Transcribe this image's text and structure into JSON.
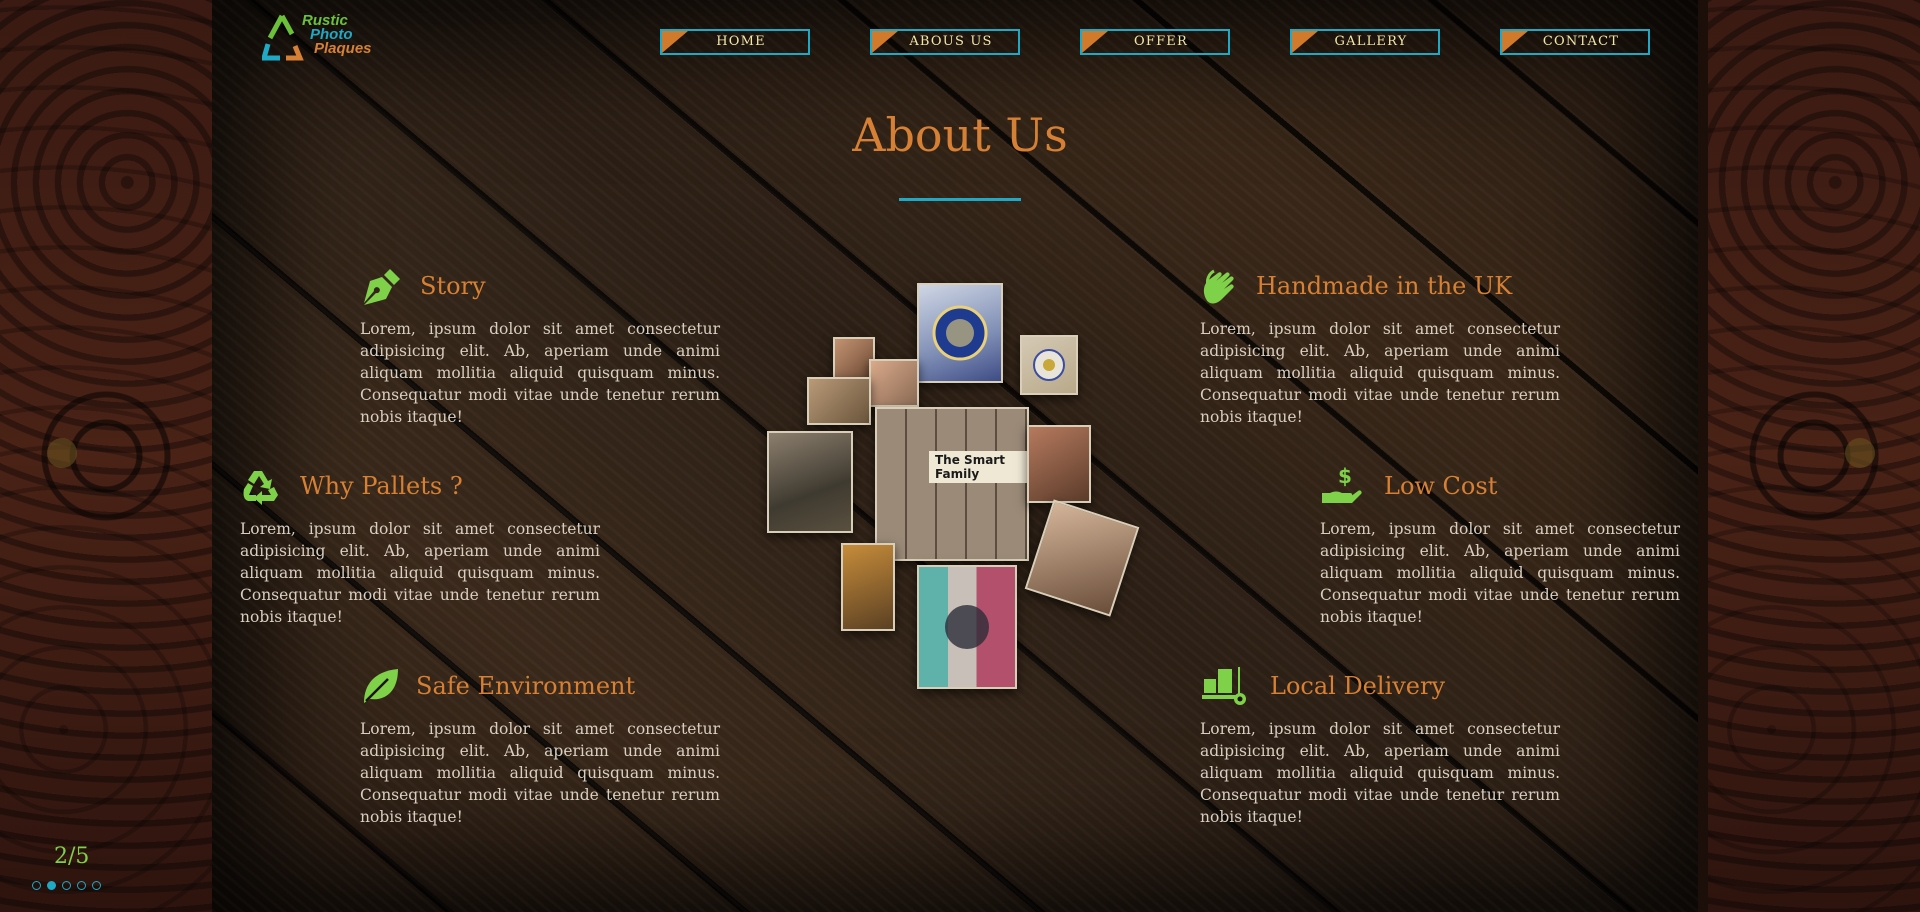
{
  "brand": {
    "logo_lines": [
      "Rustic",
      "Photo",
      "Plaques"
    ],
    "colors": {
      "rustic": "#6cc13a",
      "photo": "#1fa9c4",
      "plaques": "#d58034"
    }
  },
  "nav": [
    {
      "label": "HOME"
    },
    {
      "label": "ABOUS US"
    },
    {
      "label": "OFFER"
    },
    {
      "label": "GALLERY"
    },
    {
      "label": "CONTACT"
    }
  ],
  "page": {
    "title": "About Us"
  },
  "features": {
    "story": {
      "icon": "pen-nib-icon",
      "title": "Story",
      "body": "Lorem, ipsum dolor sit amet consectetur adipisicing elit. Ab, aperiam unde animi aliquam mollitia aliquid quisquam minus. Consequatur modi vitae unde tenetur rerum nobis itaque!"
    },
    "handmade": {
      "icon": "hands-icon",
      "title": "Handmade in the UK",
      "body": "Lorem, ipsum dolor sit amet consectetur adipisicing elit. Ab, aperiam unde animi aliquam mollitia aliquid quisquam minus. Consequatur modi vitae unde tenetur rerum nobis itaque!"
    },
    "pallets": {
      "icon": "recycle-icon",
      "title": "Why Pallets ?",
      "body": "Lorem, ipsum dolor sit amet consectetur adipisicing elit. Ab, aperiam unde animi aliquam mollitia aliquid quisquam minus. Consequatur modi vitae unde tenetur rerum nobis itaque!"
    },
    "lowcost": {
      "icon": "hand-dollar-icon",
      "title": "Low Cost",
      "body": "Lorem, ipsum dolor sit amet consectetur adipisicing elit. Ab, aperiam unde animi aliquam mollitia aliquid quisquam minus. Consequatur modi vitae unde tenetur rerum nobis itaque!"
    },
    "safe": {
      "icon": "leaf-icon",
      "title": "Safe Environment",
      "body": "Lorem, ipsum dolor sit amet consectetur adipisicing elit. Ab, aperiam unde animi aliquam mollitia aliquid quisquam minus. Consequatur modi vitae unde tenetur rerum nobis itaque!"
    },
    "delivery": {
      "icon": "dolly-icon",
      "title": "Local Delivery",
      "body": "Lorem, ipsum dolor sit amet consectetur adipisicing elit. Ab, aperiam unde animi aliquam mollitia aliquid quisquam minus. Consequatur modi vitae unde tenetur rerum nobis itaque!"
    }
  },
  "collage": {
    "caption": "The Smart Family"
  },
  "pagination": {
    "counter": "2/5",
    "total": 5,
    "active": 2
  },
  "theme": {
    "accent": "#d58034",
    "line": "#1fa9c4",
    "icon": "#7fd14a",
    "nav_text": "#f3e7a8"
  }
}
